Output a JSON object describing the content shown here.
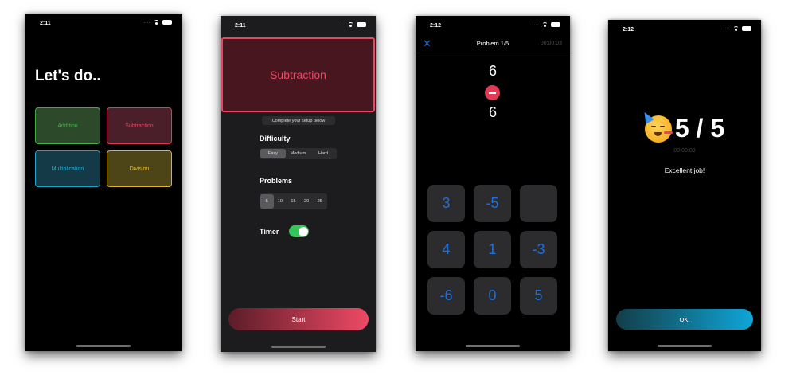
{
  "screen1": {
    "time": "2:11",
    "headline": "Let's do..",
    "operations": [
      {
        "label": "Addition",
        "color": "#42b54a"
      },
      {
        "label": "Subtraction",
        "color": "#e04560"
      },
      {
        "label": "Multiplication",
        "color": "#25b0d5"
      },
      {
        "label": "Division",
        "color": "#e6bf2a"
      }
    ]
  },
  "screen2": {
    "time": "2:11",
    "operation_title": "Subtraction",
    "hint": "Complete your setup below",
    "difficulty_label": "Difficulty",
    "difficulty_options": [
      "Easy",
      "Medium",
      "Hard"
    ],
    "difficulty_selected": "Easy",
    "problems_label": "Problems",
    "problems_options": [
      "5",
      "10",
      "15",
      "20",
      "25"
    ],
    "problems_selected": "5",
    "timer_label": "Timer",
    "timer_on": true,
    "start_label": "Start"
  },
  "screen3": {
    "time": "2:12",
    "close_symbol": "✕",
    "title": "Problem 1/5",
    "timer": "00:00:03",
    "operand_top": "6",
    "operand_bottom": "6",
    "keys": [
      "3",
      "-5",
      "",
      "4",
      "1",
      "-3",
      "-6",
      "0",
      "5"
    ]
  },
  "screen4": {
    "time": "2:12",
    "score": "5 / 5",
    "elapsed": "00:00:09",
    "message": "Excellent job!",
    "ok_label": "OK."
  }
}
